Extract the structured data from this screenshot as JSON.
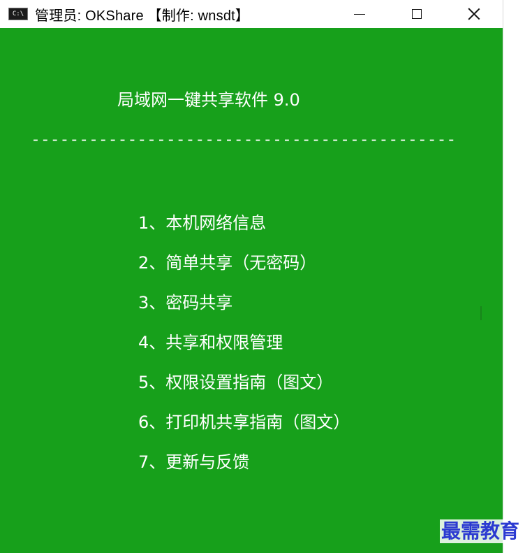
{
  "window": {
    "icon_text": "C:\\",
    "title": "管理员:  OKShare 【制作: wnsdt】",
    "controls": {
      "minimize": "",
      "maximize": "",
      "close": ""
    }
  },
  "console": {
    "title": "局域网一键共享软件 9.0",
    "separator": "--------------------------------------------",
    "menu": [
      {
        "label": "1、本机网络信息"
      },
      {
        "label": "2、简单共享（无密码）"
      },
      {
        "label": "3、密码共享"
      },
      {
        "label": "4、共享和权限管理"
      },
      {
        "label": "5、权限设置指南（图文）"
      },
      {
        "label": "6、打印机共享指南（图文）"
      },
      {
        "label": "7、更新与反馈"
      }
    ]
  },
  "watermark": {
    "text": "最需教育"
  },
  "colors": {
    "console_background": "#17a01b",
    "console_text": "#ffffff",
    "titlebar_background": "#ffffff",
    "watermark_text": "#2b3ad1"
  }
}
